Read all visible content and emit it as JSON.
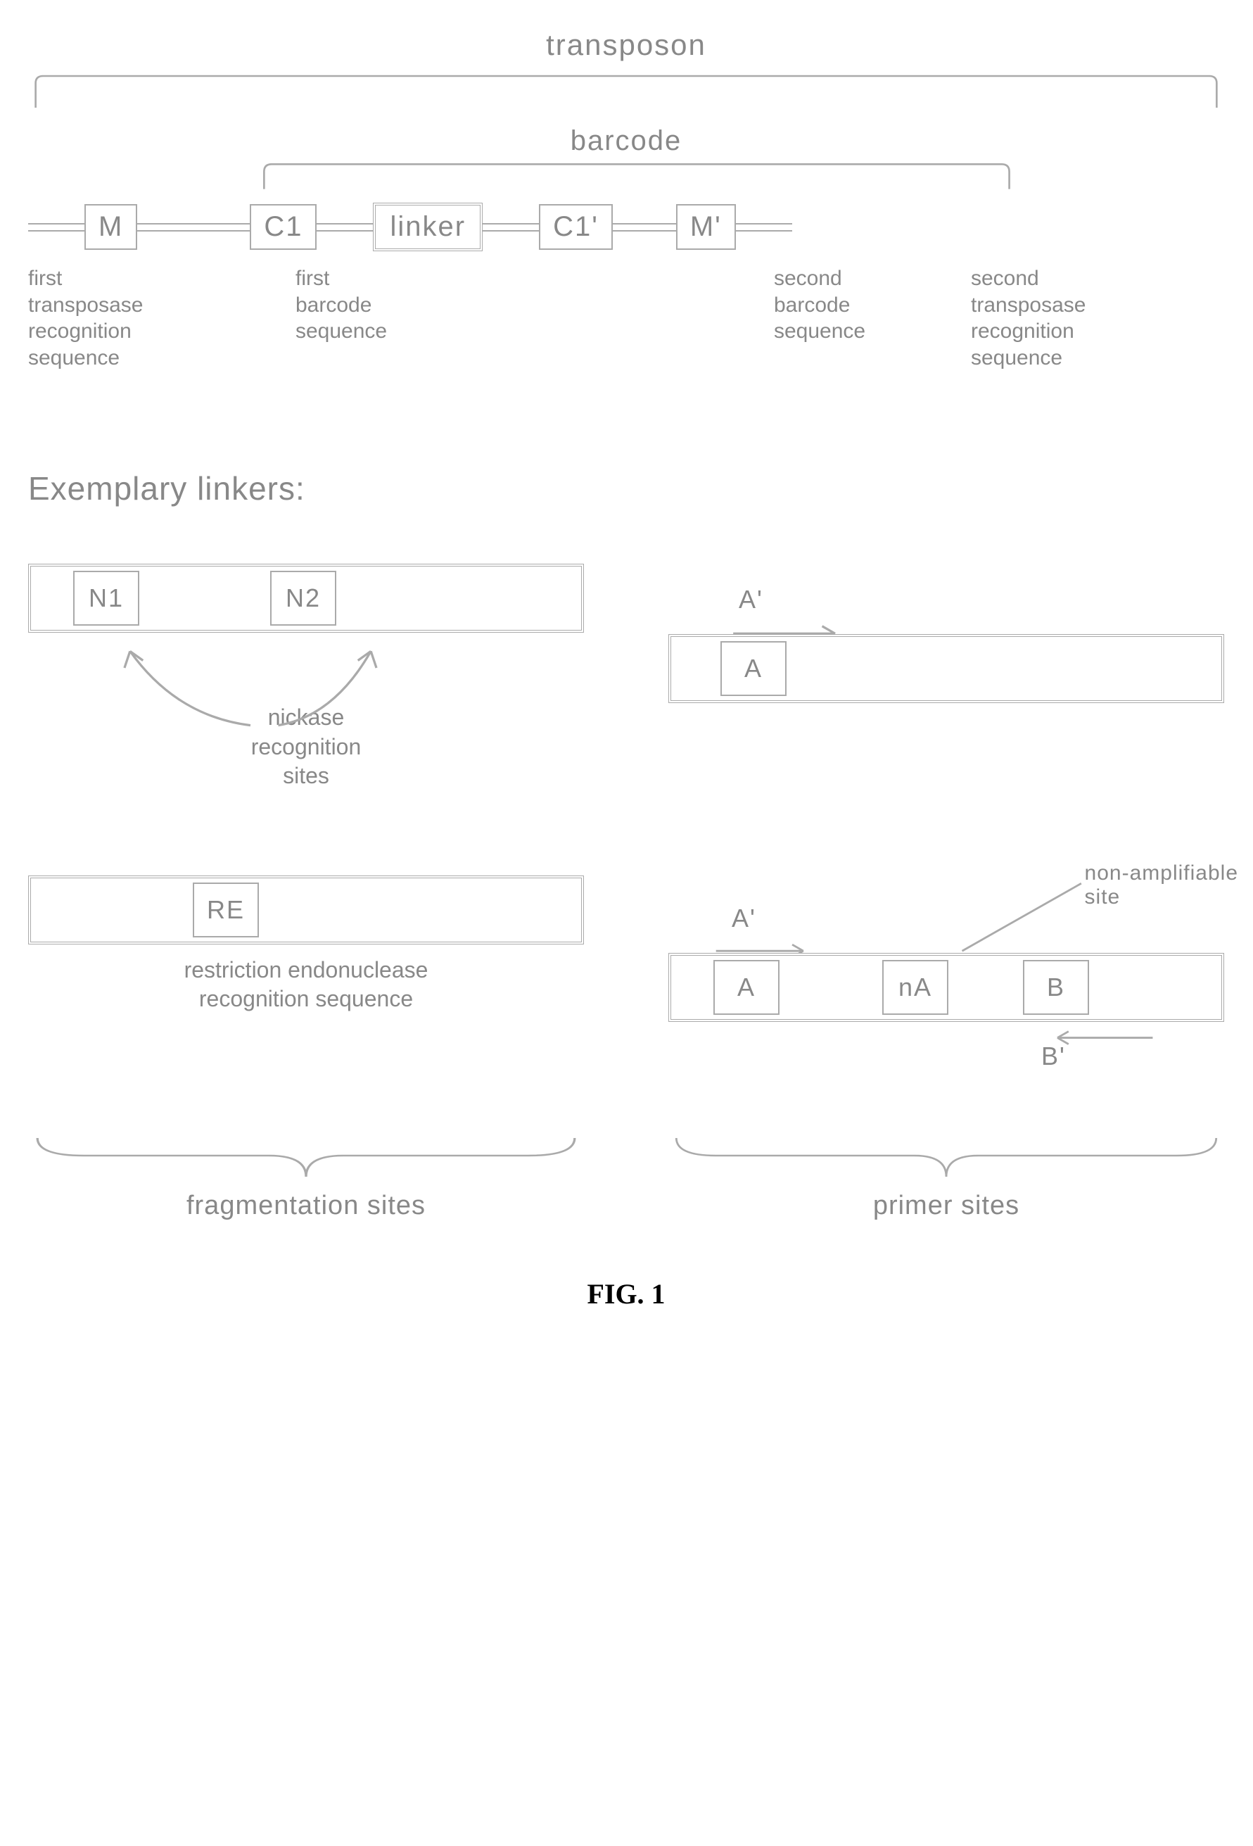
{
  "figure_caption": "FIG. 1",
  "top": {
    "transposon_label": "transposon",
    "barcode_label": "barcode",
    "boxes": {
      "M": "M",
      "C1": "C1",
      "linker": "linker",
      "C1p": "C1'",
      "Mp": "M'"
    },
    "annotations": {
      "M": "first\ntransposase\nrecognition\nsequence",
      "C1": "first\nbarcode\nsequence",
      "C1p": "second\nbarcode\nsequence",
      "Mp": "second\ntransposase\nrecognition\nsequence"
    }
  },
  "section_heading": "Exemplary linkers:",
  "linkers": {
    "nickase": {
      "N1": "N1",
      "N2": "N2",
      "caption": "nickase\nrecognition\nsites"
    },
    "primerA": {
      "A": "A",
      "Aprime": "A'"
    },
    "re": {
      "RE": "RE",
      "caption": "restriction endonuclease\nrecognition sequence"
    },
    "nonamp": {
      "A": "A",
      "nA": "nA",
      "B": "B",
      "Aprime": "A'",
      "Bprime": "B'",
      "caption": "non-amplifiable\nsite"
    }
  },
  "group_labels": {
    "left": "fragmentation sites",
    "right": "primer sites"
  }
}
